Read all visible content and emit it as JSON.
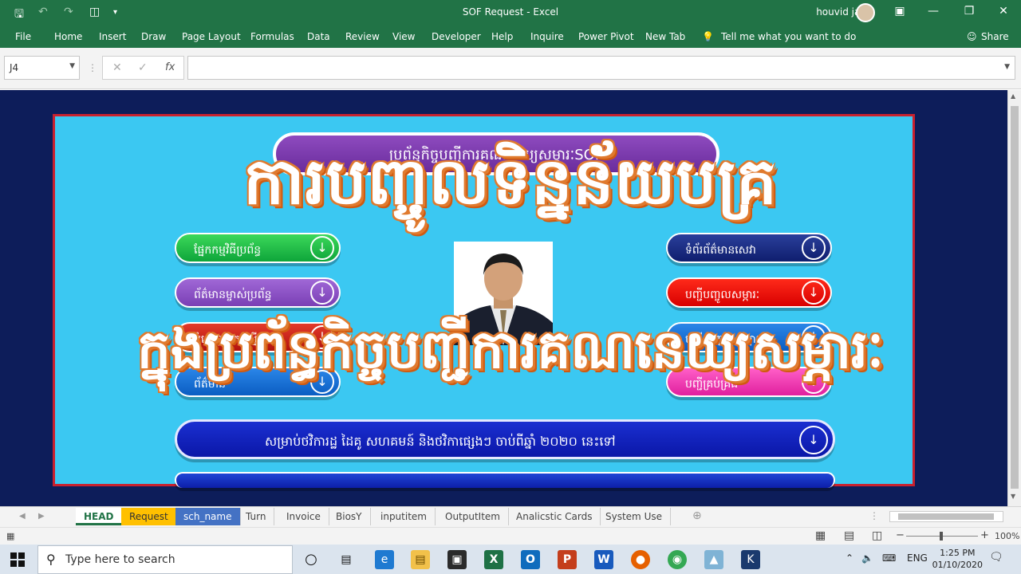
{
  "window": {
    "title": "SOF Request  -  Excel",
    "user": "houvid jam"
  },
  "ribbon": {
    "tabs": [
      "File",
      "Home",
      "Insert",
      "Draw",
      "Page Layout",
      "Formulas",
      "Data",
      "Review",
      "View",
      "Developer",
      "Help",
      "Inquire",
      "Power Pivot",
      "New Tab"
    ],
    "tell_me": "Tell me what you want to do",
    "share": "Share"
  },
  "formula_bar": {
    "name_box": "J4",
    "formula": ""
  },
  "dashboard": {
    "banner": "ប្រព័ន្ធកិច្ចបញ្ជីការគណនេយ្យសម្ភារៈSOF",
    "left_buttons": [
      "ផ្នែកកម្មវិធីប្រព័ន្ធ",
      "ព័ត៌មានម្ចាស់ប្រព័ន្ធ",
      "បំពេញពាក្យស្នើសុំ",
      "ព័ត៌មាន"
    ],
    "right_buttons": [
      "ទំព័រព័ត៌មានសេវា",
      "បញ្ជីបញ្ចូលសម្ភារៈ",
      "បញ្ជីបញ្ចេញសម្ភារៈ",
      "បញ្ជីគ្រប់គ្រង"
    ],
    "long_button": "សម្រាប់ថវិការដ្ឋ ដៃគូ សហគមន៍ និងថវិកាផ្សេងៗ ចាប់ពីឆ្នាំ ២០២០ នេះទៅ",
    "overlay_line1": "ការបញ្ចូលទិន្នន័យបគ្រ",
    "overlay_line2": "ក្នុងប្រព័ន្ធកិច្ចបញ្ជីការគណនេយ្យសម្ភារៈ"
  },
  "sheet_tabs": [
    "HEAD",
    "Request",
    "sch_name",
    "Turn",
    "Invoice",
    "BiosY",
    "inputitem",
    "OutputItem",
    "Analicstic Cards",
    "System Use"
  ],
  "status": {
    "zoom": "100%"
  },
  "taskbar": {
    "search_placeholder": "Type here to search",
    "language": "ENG",
    "time": "1:25 PM",
    "date": "01/10/2020"
  }
}
